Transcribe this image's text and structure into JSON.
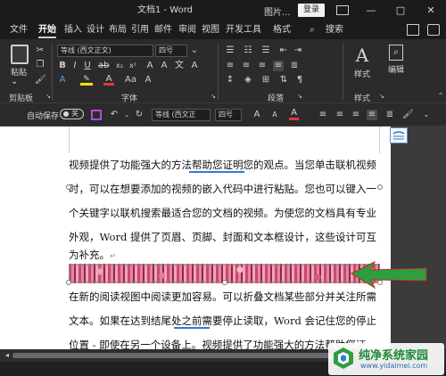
{
  "title_bar": {
    "doc_title": "文档1 - Word",
    "picture_label": "图片...",
    "login": "登录",
    "minimize": "—",
    "restore": "□",
    "close": "✕"
  },
  "menu": {
    "tabs": [
      "文件",
      "开始",
      "插入",
      "设计",
      "布局",
      "引用",
      "邮件",
      "审阅",
      "视图",
      "开发工具",
      "格式"
    ],
    "search": "搜索"
  },
  "ribbon": {
    "paste": "粘贴",
    "font_name": "等线 (西文正文)",
    "font_size": "四号",
    "styles": "样式",
    "editing": "编辑",
    "groups": {
      "clipboard": "剪贴板",
      "font": "字体",
      "paragraph": "段落",
      "styles": "样式"
    }
  },
  "qat": {
    "autosave": "自动保存",
    "toggle": "关",
    "font_name": "等线 (西文正",
    "font_size": "四号"
  },
  "document": {
    "lines": [
      "视频提供了功能强大的方法帮助您证明您的观点。当您单击联机视频",
      "时，可以在想要添加的视频的嵌入代码中进行粘贴。您也可以键入一",
      "个关键字以联机搜索最适合您的文档的视频。为使您的文档具有专业",
      "外观，Word 提供了页眉、页脚、封面和文本框设计，这些设计可互",
      "为补充。",
      "在新的阅读视图中阅读更加容易。可以折叠文档某些部分并关注所需",
      "文本。如果在达到结尾处之前需要停止读取，Word 会记住您的停止",
      "位置 - 即使在另一个设备上。视频提供了功能强大的方法帮助您证"
    ],
    "paragraph_mark": "↵"
  },
  "watermark": {
    "name": "纯净系统家园",
    "url": "www.yidaimei.com"
  },
  "colors": {
    "accent": "#2f7bd6",
    "arrow": "#2e9e3e",
    "highlight": "#f5e100",
    "font_red": "#e03a3a"
  }
}
